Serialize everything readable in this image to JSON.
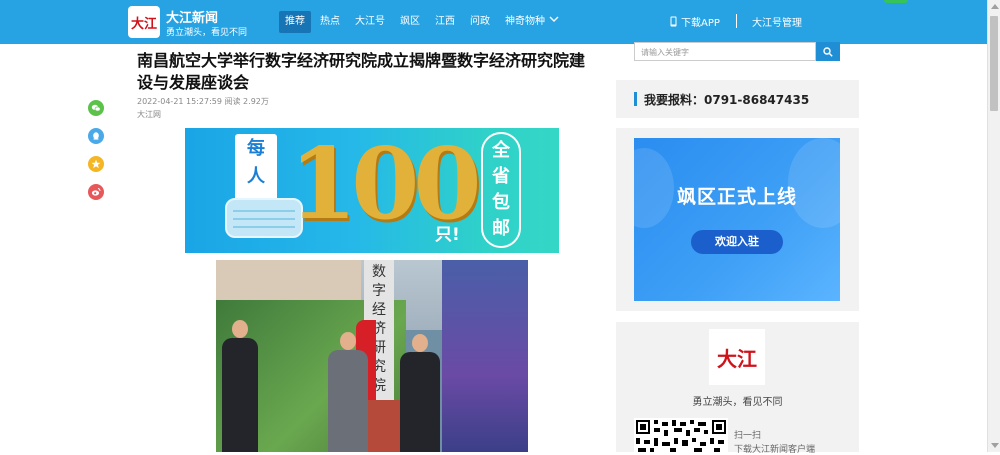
{
  "header": {
    "logo_text": "大江",
    "brand_name": "大江新闻",
    "slogan": "勇立潮头，看见不同",
    "nav": [
      "推荐",
      "热点",
      "大江号",
      "飒区",
      "江西",
      "问政",
      "神奇物种"
    ],
    "active_nav": "推荐",
    "download_app": "下载APP",
    "manage": "大江号管理"
  },
  "article": {
    "title": "南昌航空大学举行数字经济研究院成立揭牌暨数字经济研究院建设与发展座谈会",
    "date": "2022-04-21 15:27:59",
    "reads": "阅读 2.92万",
    "source": "大江网"
  },
  "banner": {
    "left_chars": [
      "每",
      "人"
    ],
    "number": "100",
    "unit": "只!",
    "right_chars": [
      "全",
      "省",
      "包",
      "邮"
    ]
  },
  "photo": {
    "plaque_text": "数字经济研究院"
  },
  "share_icons": [
    {
      "name": "wechat-share-icon",
      "color": "#5cc24a"
    },
    {
      "name": "qq-share-icon",
      "color": "#4aa9e9"
    },
    {
      "name": "qzone-share-icon",
      "color": "#f5b625"
    },
    {
      "name": "weibo-share-icon",
      "color": "#e8575a"
    }
  ],
  "sidebar": {
    "search_placeholder": "请输入关键字",
    "report_label": "我要报料：0791-86847435",
    "ad_title": "飒区正式上线",
    "ad_button": "欢迎入驻",
    "app_logo": "大江",
    "app_slogan": "勇立潮头，看见不同",
    "scan_line1": "扫一扫",
    "scan_line2": "下载大江新闻客户端"
  },
  "colors": {
    "header_bg": "#27a3e3",
    "nav_active": "#1775b6",
    "accent": "#1f8ed4",
    "brand_red": "#d0121b"
  }
}
